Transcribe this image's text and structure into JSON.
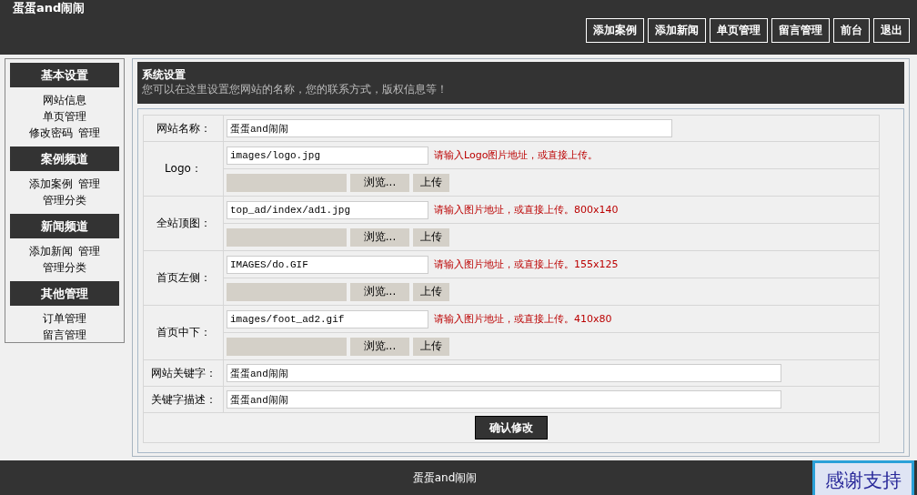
{
  "site_title": "蛋蛋and闹闹",
  "nav_buttons": [
    "添加案例",
    "添加新闻",
    "单页管理",
    "留言管理",
    "前台",
    "退出"
  ],
  "sidebar": [
    {
      "title": "基本设置",
      "lines": [
        [
          "网站信息"
        ],
        [
          "单页管理"
        ],
        [
          "修改密码",
          "管理"
        ]
      ]
    },
    {
      "title": "案例频道",
      "lines": [
        [
          "添加案例",
          "管理"
        ],
        [
          "管理分类"
        ]
      ]
    },
    {
      "title": "新闻频道",
      "lines": [
        [
          "添加新闻",
          "管理"
        ],
        [
          "管理分类"
        ]
      ]
    },
    {
      "title": "其他管理",
      "lines": [
        [
          "订单管理"
        ],
        [
          "留言管理"
        ]
      ]
    }
  ],
  "panel": {
    "title": "系统设置",
    "description": "您可以在这里设置您网站的名称，您的联系方式，版权信息等！"
  },
  "form_rows": [
    {
      "kind": "medium_text",
      "label": "网站名称：",
      "value": "蛋蛋and闹闹"
    },
    {
      "kind": "image",
      "label": "Logo：",
      "value": "images/logo.jpg",
      "hint": "请输入Logo图片地址，或直接上传。",
      "browse": "浏览...",
      "upload": "上传"
    },
    {
      "kind": "image",
      "label": "全站顶图：",
      "value": "top_ad/index/ad1.jpg",
      "hint": "请输入图片地址，或直接上传。800x140",
      "browse": "浏览...",
      "upload": "上传"
    },
    {
      "kind": "image",
      "label": "首页左侧：",
      "value": "IMAGES/do.GIF",
      "hint": "请输入图片地址，或直接上传。155x125",
      "browse": "浏览...",
      "upload": "上传"
    },
    {
      "kind": "image",
      "label": "首页中下：",
      "value": "images/foot_ad2.gif",
      "hint": "请输入图片地址，或直接上传。410x80",
      "browse": "浏览...",
      "upload": "上传"
    },
    {
      "kind": "long_text",
      "label": "网站关键字：",
      "value": "蛋蛋and闹闹"
    },
    {
      "kind": "long_text",
      "label": "关键字描述：",
      "value": "蛋蛋and闹闹"
    }
  ],
  "submit": "确认修改",
  "footer": "蛋蛋and闹闹",
  "support_badge": "感谢支持"
}
